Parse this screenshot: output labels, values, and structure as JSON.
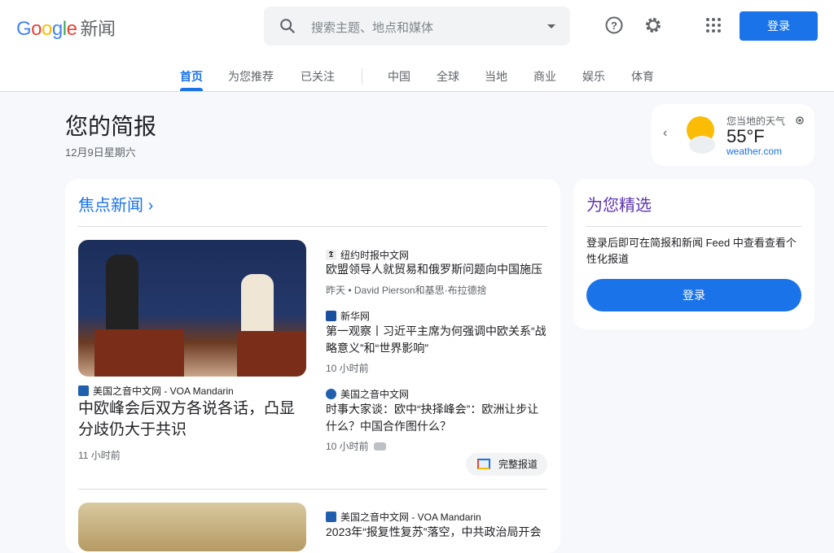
{
  "header": {
    "logo_letters": [
      "G",
      "o",
      "o",
      "g",
      "l",
      "e"
    ],
    "logo_colors": [
      "#4285f4",
      "#ea4335",
      "#fbbc05",
      "#4285f4",
      "#34a853",
      "#ea4335"
    ],
    "logo_suffix": "新闻",
    "search_placeholder": "搜索主题、地点和媒体",
    "login": "登录"
  },
  "nav": [
    {
      "label": "首页",
      "active": true
    },
    {
      "label": "为您推荐"
    },
    {
      "label": "已关注"
    },
    {
      "label": "中国"
    },
    {
      "label": "全球"
    },
    {
      "label": "当地"
    },
    {
      "label": "商业"
    },
    {
      "label": "娱乐"
    },
    {
      "label": "体育"
    }
  ],
  "briefing": {
    "title": "您的简报",
    "date": "12月9日星期六"
  },
  "weather": {
    "label": "您当地的天气",
    "temp": "55°F",
    "source": "weather.com"
  },
  "top_stories": {
    "title": "焦点新闻",
    "main": {
      "source": "美国之音中文网 - VOA Mandarin",
      "headline": "中欧峰会后双方各说各话，凸显分歧仍大于共识",
      "time": "11 小时前"
    },
    "related": [
      {
        "source": "纽约时报中文网",
        "headline": "欧盟领导人就贸易和俄罗斯问题向中国施压",
        "meta": "昨天 • David Pierson和基思·布拉德捨"
      },
      {
        "source": "新华网",
        "headline": "第一观察丨习近平主席为何强调中欧关系“战略意义”和“世界影响”",
        "meta": "10 小时前"
      },
      {
        "source": "美国之音中文网",
        "headline": "时事大家谈：欧中“抉择峰会”：欧洲让步让什么？中国合作图什么？",
        "meta": "10 小时前"
      }
    ],
    "full_coverage": "完整报道",
    "next": {
      "source": "美国之音中文网 - VOA Mandarin",
      "headline": "2023年“报复性复苏”落空，中共政治局开会"
    }
  },
  "for_you": {
    "title": "为您精选",
    "text": "登录后即可在简报和新闻 Feed 中查看查看个性化报道",
    "login": "登录"
  }
}
